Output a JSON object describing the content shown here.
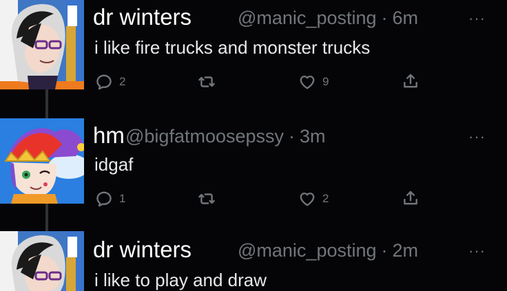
{
  "tweets": [
    {
      "display_name": "dr winters",
      "handle": "@manic_posting",
      "time": "6m",
      "text": "i like fire trucks and monster trucks",
      "replies": "2",
      "retweets": "",
      "likes": "9"
    },
    {
      "display_name": "hm",
      "handle": "@bigfatmoosepssy",
      "time": "3m",
      "text": "idgaf",
      "replies": "1",
      "retweets": "",
      "likes": "2"
    },
    {
      "display_name": "dr winters",
      "handle": "@manic_posting",
      "time": "2m",
      "text": "i like to play and draw"
    }
  ],
  "separator": "·",
  "more_glyph": "···",
  "colors": {
    "background": "#050507",
    "text": "#e7e9ea",
    "muted": "#71767b",
    "thread_line": "#2f3336"
  },
  "icons": [
    "reply-icon",
    "retweet-icon",
    "like-icon",
    "share-icon",
    "more-icon"
  ]
}
